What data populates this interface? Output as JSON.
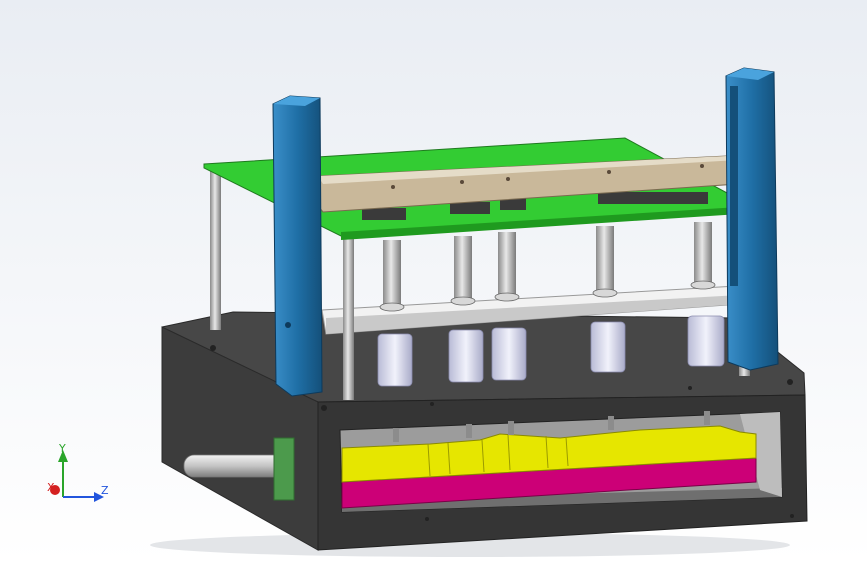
{
  "view": {
    "background_top": "#e9edf3",
    "background_bottom": "#ffffff"
  },
  "colors": {
    "housing_dark": "#3b3b3b",
    "housing_top": "#4a4a4a",
    "housing_front": "#333333",
    "cavity_gray": "#9a9a9a",
    "guide_post_blue": "#1f6fa6",
    "guide_post_blue_light": "#3b8fc9",
    "green_plate": "#33cc33",
    "tan_bar": "#c9b89a",
    "white_plate": "#f2f2f2",
    "bushing_lavender": "#dadcf0",
    "yellow_part": "#e6e600",
    "magenta_part": "#cc0077",
    "rod_silver": "#b8b8b8",
    "connector_green": "#4c9a4c"
  },
  "triad": {
    "x_label": "X",
    "y_label": "Y",
    "z_label": "Z",
    "x_color": "#d42020",
    "y_color": "#2aa52a",
    "z_color": "#2255dd"
  }
}
